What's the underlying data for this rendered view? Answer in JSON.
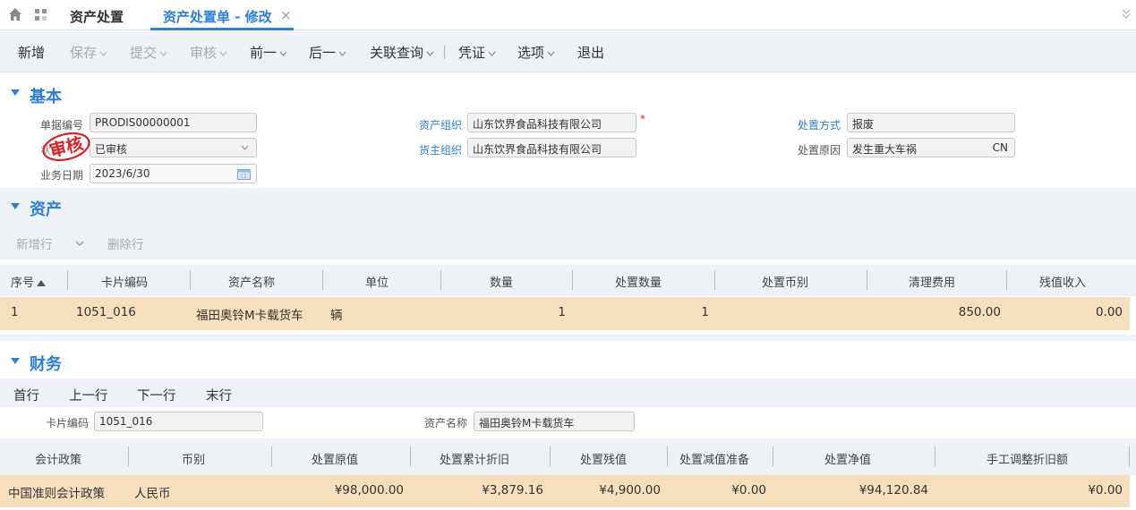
{
  "tabs": {
    "home_tab": "资产处置",
    "active_tab": "资产处置单 - 修改",
    "close": "×"
  },
  "toolbar": {
    "new": "新增",
    "save": "保存",
    "submit": "提交",
    "audit": "审核",
    "prev": "前一",
    "next": "后一",
    "related": "关联查询",
    "divider": "|",
    "voucher": "凭证",
    "options": "选项",
    "exit": "退出"
  },
  "basic": {
    "title": "基本",
    "bill_no_label": "单据编号",
    "bill_no": "PRODIS00000001",
    "status_label": "状态",
    "status": "已审核",
    "stamp": "审核",
    "date_label": "业务日期",
    "date": "2023/6/30",
    "asset_org_label": "资产组织",
    "asset_org": "山东饮界食品科技有限公司",
    "required": "*",
    "owner_org_label": "货主组织",
    "owner_org": "山东饮界食品科技有限公司",
    "method_label": "处置方式",
    "method": "报废",
    "reason_label": "处置原因",
    "reason": "发生重大车祸",
    "reason_lang": "CN"
  },
  "asset": {
    "title": "资产",
    "add_row": "新增行",
    "delete_row": "删除行",
    "columns": [
      "序号",
      "卡片编码",
      "资产名称",
      "单位",
      "数量",
      "处置数量",
      "处置币别",
      "清理费用",
      "残值收入"
    ],
    "rows": [
      {
        "seq": "1",
        "card_code": "1051_016",
        "asset_name": "福田奥铃M卡载货车",
        "unit": "辆",
        "qty": "1",
        "disp_qty": "1",
        "currency": "",
        "clear_fee": "850.00",
        "residual": "0.00"
      }
    ]
  },
  "finance": {
    "title": "财务",
    "nav": {
      "first": "首行",
      "prev": "上一行",
      "next": "下一行",
      "last": "末行"
    },
    "card_code_label": "卡片编码",
    "card_code": "1051_016",
    "asset_name_label": "资产名称",
    "asset_name": "福田奥铃M卡载货车",
    "columns": [
      "会计政策",
      "币别",
      "处置原值",
      "处置累计折旧",
      "处置残值",
      "处置减值准备",
      "处置净值",
      "手工调整折旧额"
    ],
    "rows": [
      {
        "policy": "中国准则会计政策",
        "currency": "人民币",
        "orig": "¥98,000.00",
        "acc_dep": "¥3,879.16",
        "residual": "¥4,900.00",
        "impair": "¥0.00",
        "net": "¥94,120.84",
        "manual": "¥0.00"
      }
    ]
  },
  "colors": {
    "accent": "#2d7fd9",
    "row_highlight": "#f7dfbe",
    "stamp": "#d9232c"
  }
}
